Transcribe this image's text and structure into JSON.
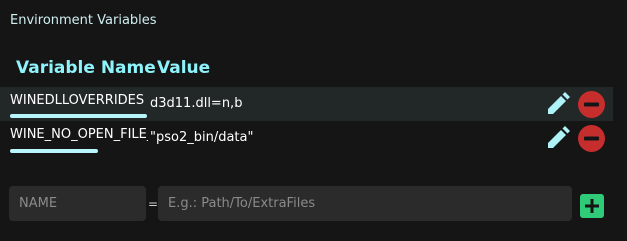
{
  "section": {
    "title": "Environment Variables"
  },
  "table": {
    "headers": {
      "name": "Variable Name",
      "value": "Value"
    },
    "rows": [
      {
        "name": "WINEDLLOVERRIDES",
        "value": "d3d11.dll=n,b",
        "edit_icon": "pencil-icon",
        "remove_icon": "minus-circle-icon"
      },
      {
        "name": "WINE_NO_OPEN_FILE_SEARCH",
        "value": "\"pso2_bin/data\"",
        "edit_icon": "pencil-icon",
        "remove_icon": "minus-circle-icon"
      }
    ]
  },
  "new_entry": {
    "name_placeholder": "NAME",
    "equals": "=",
    "value_placeholder": "E.g.: Path/To/ExtraFiles",
    "add_icon": "plus-icon"
  },
  "colors": {
    "background": "#151515",
    "header_accent": "#8ef3fb",
    "edit_icon": "#aef1f7",
    "remove_icon": "#c62e2e",
    "add_button": "#2fcb79",
    "selected_row": "#222728"
  }
}
